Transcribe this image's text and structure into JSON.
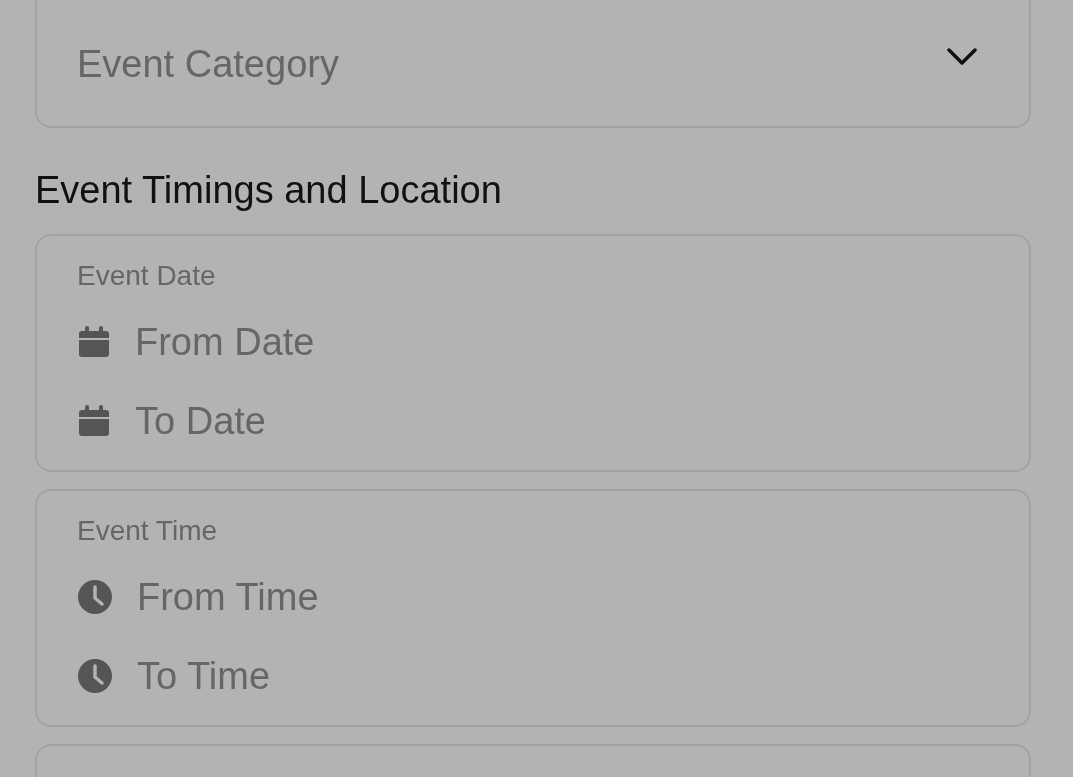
{
  "category_select": {
    "placeholder": "Event Category"
  },
  "section_title": "Event Timings and Location",
  "groups": [
    {
      "label": "Event Date",
      "fields": [
        {
          "kind": "date",
          "placeholder": "From Date"
        },
        {
          "kind": "date",
          "placeholder": "To Date"
        }
      ]
    },
    {
      "label": "Event Time",
      "fields": [
        {
          "kind": "time",
          "placeholder": "From Time"
        },
        {
          "kind": "time",
          "placeholder": "To Time"
        }
      ]
    }
  ]
}
